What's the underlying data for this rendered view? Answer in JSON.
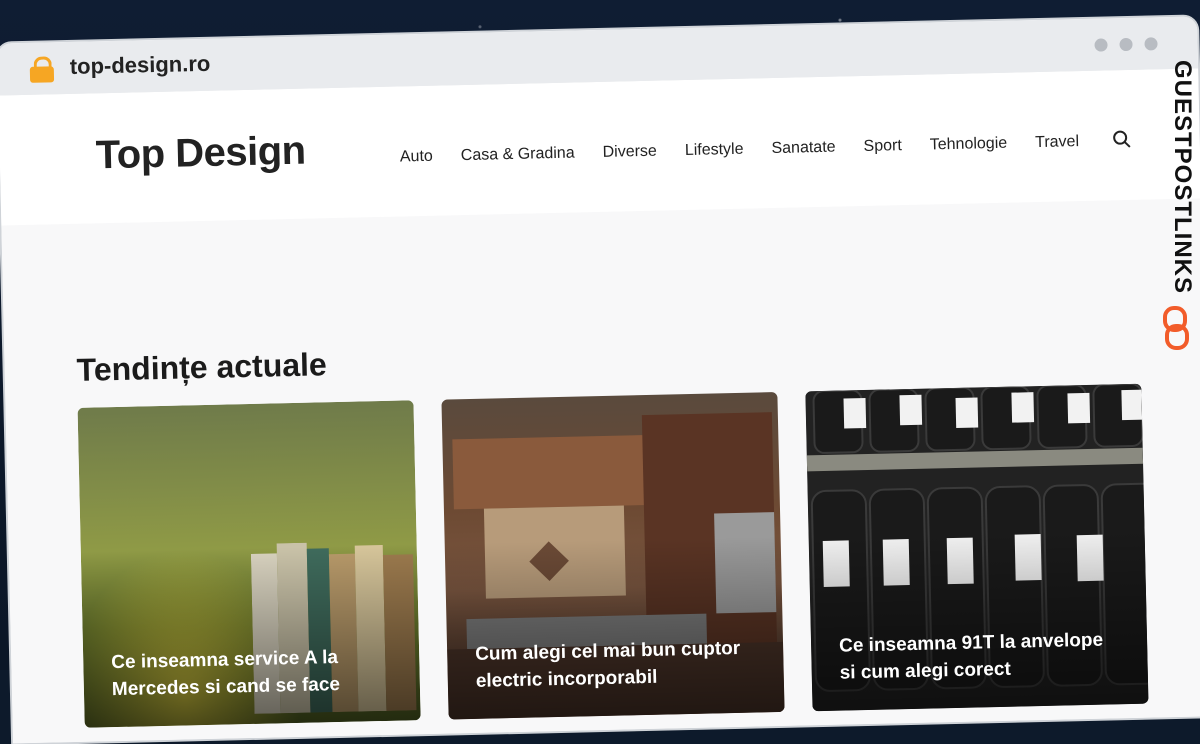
{
  "browser": {
    "url": "top-design.ro"
  },
  "site": {
    "logo": "Top Design",
    "nav": [
      "Auto",
      "Casa & Gradina",
      "Diverse",
      "Lifestyle",
      "Sanatate",
      "Sport",
      "Tehnologie",
      "Travel"
    ]
  },
  "section": {
    "title": "Tendințe actuale"
  },
  "cards": [
    {
      "title": "Ce inseamna service A la Mercedes si cand se face"
    },
    {
      "title": "Cum alegi cel mai bun cuptor electric incorporabil"
    },
    {
      "title": "Ce inseamna 91T la anvelope si cum alegi corect"
    }
  ],
  "watermark": "GUESTPOSTLINKS",
  "colors": {
    "accent": "#f6a623",
    "brand_watermark": "#f25c2a"
  }
}
